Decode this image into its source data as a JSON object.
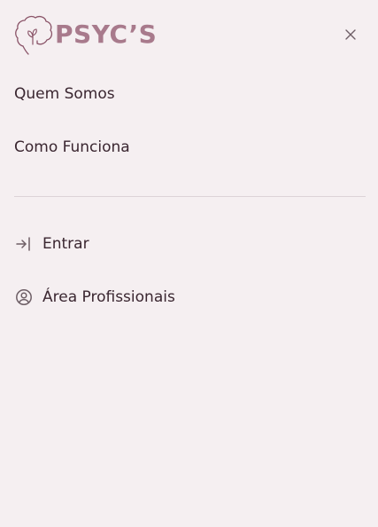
{
  "brand": {
    "name": "PSYC’S",
    "logo_icon": "brain-leaf-icon",
    "color": "#a87a8c"
  },
  "header": {
    "close_icon": "close-icon"
  },
  "nav": {
    "items": [
      {
        "label": "Quem Somos"
      },
      {
        "label": "Como Funciona"
      }
    ]
  },
  "actions": [
    {
      "label": "Entrar",
      "icon": "login-arrow-icon"
    },
    {
      "label": "Área Profissionais",
      "icon": "user-circle-icon"
    }
  ],
  "colors": {
    "background": "#f5eff1",
    "text": "#3a2630",
    "divider": "#dcd3d7"
  }
}
